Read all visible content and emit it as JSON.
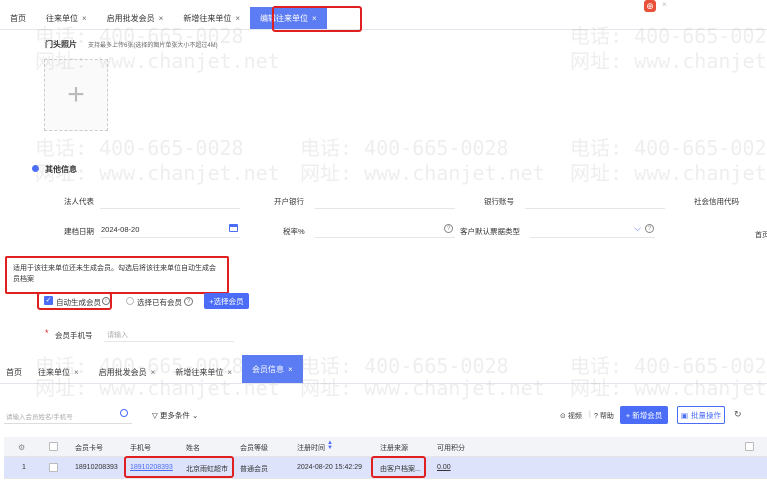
{
  "top_tabs": [
    {
      "label": "首页",
      "closable": false
    },
    {
      "label": "往来单位",
      "closable": true
    },
    {
      "label": "启用批发会员",
      "closable": true
    },
    {
      "label": "新增往来单位",
      "closable": true
    },
    {
      "label": "编辑往来单位",
      "closable": true
    }
  ],
  "top_right_icon_glyph": "⊕",
  "close_glyph": "×",
  "watermarks": {
    "phone": "电话: 400-665-0028",
    "site": "网址: www.chanjet.net"
  },
  "store_photo": {
    "label": "门头照片",
    "hint": "支持最多上传6张(选择的图片单张大小不超过4M)",
    "upload_glyph": "+"
  },
  "other_info": {
    "section_title": "其他信息",
    "fields": {
      "legal_rep": "法人代表",
      "bank": "开户银行",
      "bank_account": "银行账号",
      "credit_code": "社会信用代码",
      "setup_date_label": "建档日期",
      "setup_date_value": "2024-08-20",
      "tax_rate": "税率%",
      "invoice_type": "客户默认票据类型",
      "cut_text": "首页"
    }
  },
  "tooltip": {
    "text": "适用于该往来单位还未生成会员。勾选后将该往来单位自动生成会员档案"
  },
  "member_options": {
    "auto_generate_label": "自动生成会员",
    "auto_generate_checked": true,
    "select_existing_label": "选择已有会员",
    "select_button": "+选择会员",
    "phone_label": "会员手机号",
    "phone_placeholder": "请输入",
    "required_mark": "*"
  },
  "bottom_tabs": [
    {
      "label": "首页",
      "closable": false
    },
    {
      "label": "往来单位",
      "closable": true
    },
    {
      "label": "启用批发会员",
      "closable": true
    },
    {
      "label": "新增往来单位",
      "closable": true
    },
    {
      "label": "会员信息",
      "closable": true
    }
  ],
  "member_list": {
    "search_placeholder": "请输入会员姓名/手机号",
    "more_filters": "更多条件",
    "video": "视频",
    "help": "帮助",
    "add_button": "+ 新增会员",
    "batch_button": "批量操作",
    "columns": [
      "会员卡号",
      "手机号",
      "姓名",
      "会员等级",
      "注册时间",
      "注册来源",
      "可用积分"
    ],
    "rows": [
      {
        "index": "1",
        "card_no": "18910208393",
        "phone": "18910208393",
        "name": "北京雨虹超市",
        "level": "普通会员",
        "reg_time": "2024-08-20 15:42:29",
        "source": "由客户档案...",
        "points": "0.00"
      }
    ]
  },
  "colors": {
    "primary": "#4a6cf7",
    "active_tab": "#5b7cf2",
    "highlight_red": "#e02020",
    "selected_row": "#dde3fb"
  }
}
